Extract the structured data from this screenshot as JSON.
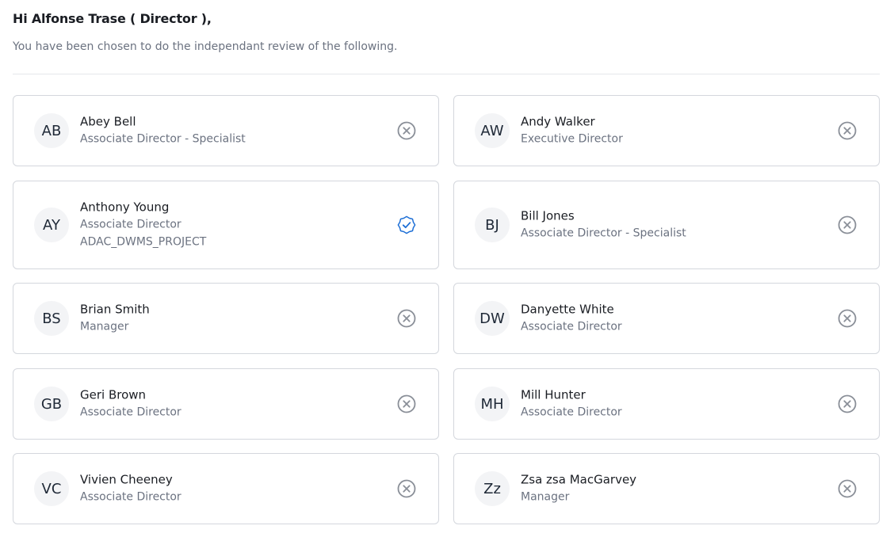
{
  "header": {
    "greeting": "Hi Alfonse Trase ( Director ),",
    "intro": "You have been chosen to do the independant review of the following."
  },
  "colors": {
    "unselected_icon": "#8a8f98",
    "selected_icon": "#1d6fd6",
    "card_border": "#d4d7dd",
    "avatar_bg": "#f3f4f6"
  },
  "people": [
    {
      "initials": "AB",
      "name": "Abey Bell",
      "role": "Associate Director - Specialist",
      "project": "",
      "status_icon": "circle-x-icon",
      "selected": false
    },
    {
      "initials": "AW",
      "name": "Andy Walker",
      "role": "Executive Director",
      "project": "",
      "status_icon": "circle-x-icon",
      "selected": false
    },
    {
      "initials": "AY",
      "name": "Anthony Young",
      "role": "Associate Director",
      "project": "ADAC_DWMS_PROJECT",
      "status_icon": "check-badge-icon",
      "selected": true
    },
    {
      "initials": "BJ",
      "name": "Bill Jones",
      "role": "Associate Director - Specialist",
      "project": "",
      "status_icon": "circle-x-icon",
      "selected": false
    },
    {
      "initials": "BS",
      "name": "Brian Smith",
      "role": "Manager",
      "project": "",
      "status_icon": "circle-x-icon",
      "selected": false
    },
    {
      "initials": "DW",
      "name": "Danyette White",
      "role": "Associate Director",
      "project": "",
      "status_icon": "circle-x-icon",
      "selected": false
    },
    {
      "initials": "GB",
      "name": "Geri Brown",
      "role": "Associate Director",
      "project": "",
      "status_icon": "circle-x-icon",
      "selected": false
    },
    {
      "initials": "MH",
      "name": "Mill Hunter",
      "role": "Associate Director",
      "project": "",
      "status_icon": "circle-x-icon",
      "selected": false
    },
    {
      "initials": "VC",
      "name": "Vivien Cheeney",
      "role": "Associate Director",
      "project": "",
      "status_icon": "circle-x-icon",
      "selected": false
    },
    {
      "initials": "Zz",
      "name": "Zsa zsa MacGarvey",
      "role": "Manager",
      "project": "",
      "status_icon": "circle-x-icon",
      "selected": false
    }
  ]
}
